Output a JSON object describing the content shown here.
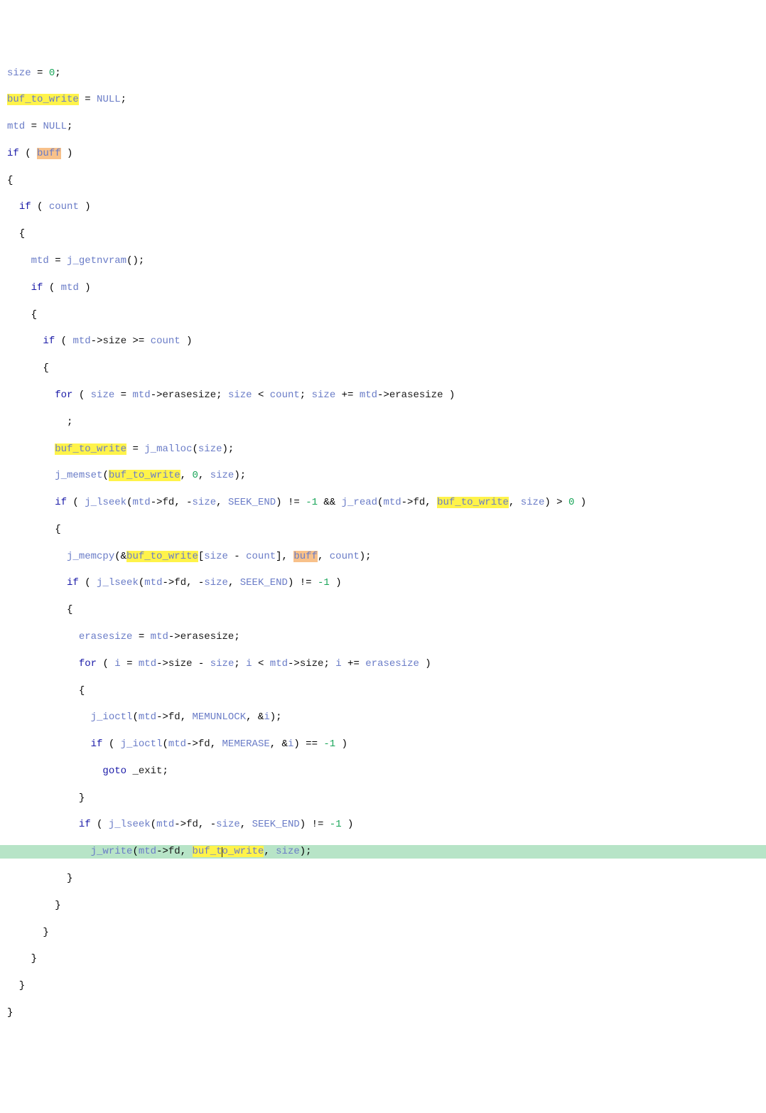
{
  "tokens": {
    "size": "size",
    "buf_to_write": "buf_to_write",
    "mtd": "mtd",
    "NULL": "NULL",
    "buff": "buff",
    "count": "count",
    "erasesize": "erasesize",
    "fd": "fd",
    "i": "i",
    "SEEK_END": "SEEK_END",
    "MEMUNLOCK": "MEMUNLOCK",
    "MEMERASE": "MEMERASE",
    "zero": "0",
    "neg1": "-1",
    "one": "1",
    "j_getnvram": "j_getnvram",
    "j_malloc": "j_malloc",
    "j_memset": "j_memset",
    "j_lseek": "j_lseek",
    "j_read": "j_read",
    "j_memcpy": "j_memcpy",
    "j_ioctl": "j_ioctl",
    "j_write": "j_write",
    "if": "if",
    "for": "for",
    "goto": "goto",
    "exit_label": "_exit"
  }
}
